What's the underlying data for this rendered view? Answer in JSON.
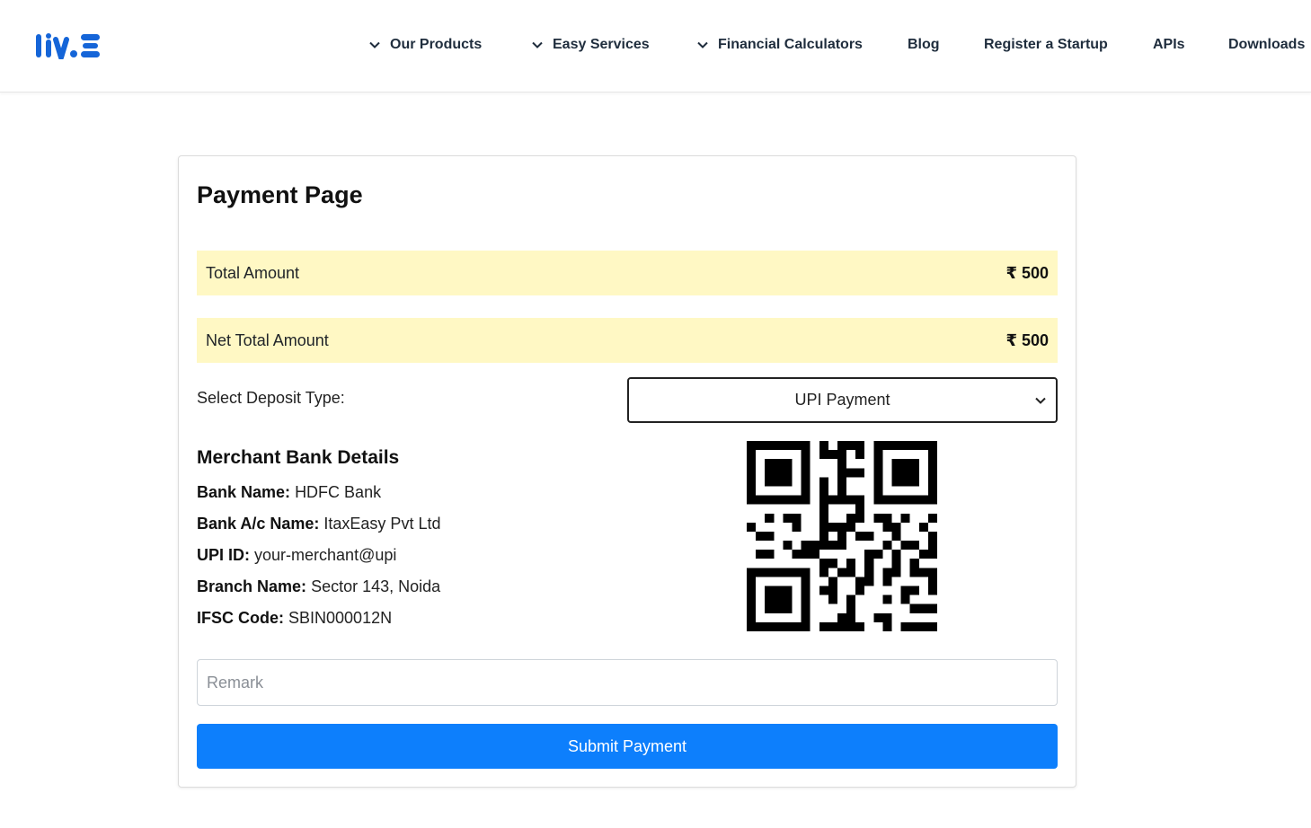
{
  "brand": {
    "logo_text": "IVE",
    "accent": "#1565d8"
  },
  "nav": {
    "items": [
      {
        "label": "Our Products",
        "dropdown": true
      },
      {
        "label": "Easy Services",
        "dropdown": true
      },
      {
        "label": "Financial Calculators",
        "dropdown": true
      },
      {
        "label": "Blog",
        "dropdown": false
      },
      {
        "label": "Register a Startup",
        "dropdown": false
      },
      {
        "label": "APIs",
        "dropdown": false
      },
      {
        "label": "Downloads",
        "dropdown": false
      }
    ]
  },
  "payment": {
    "title": "Payment Page",
    "total_label": "Total Amount",
    "total_value": "₹ 500",
    "net_label": "Net Total Amount",
    "net_value": "₹ 500",
    "deposit_label": "Select Deposit Type:",
    "deposit_selected": "UPI Payment",
    "bank_heading": "Merchant Bank Details",
    "details": [
      {
        "key": "Bank Name:",
        "value": "HDFC Bank"
      },
      {
        "key": "Bank A/c Name:",
        "value": "ItaxEasy Pvt Ltd"
      },
      {
        "key": "UPI ID:",
        "value": "your-merchant@upi"
      },
      {
        "key": "Branch Name:",
        "value": "Sector 143, Noida"
      },
      {
        "key": "IFSC Code:",
        "value": "SBIN000012N"
      }
    ],
    "remark_placeholder": "Remark",
    "submit_label": "Submit Payment"
  },
  "colors": {
    "highlight_row": "#fff8c4",
    "primary_button": "#0d7ffc"
  }
}
